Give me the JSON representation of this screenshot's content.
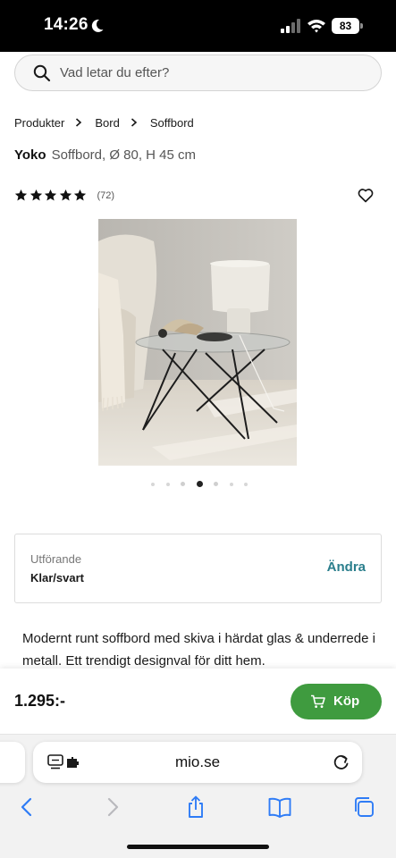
{
  "status_bar": {
    "time": "14:26",
    "battery": "83"
  },
  "search": {
    "placeholder": "Vad letar du efter?"
  },
  "breadcrumb": [
    "Produkter",
    "Bord",
    "Soffbord"
  ],
  "product": {
    "brand": "Yoko",
    "description_short": "Soffbord, Ø 80, H 45 cm",
    "rating_stars": 5,
    "rating_count": "(72)",
    "image_count": 7,
    "active_image_index": 3
  },
  "variant": {
    "label": "Utförande",
    "value": "Klar/svart",
    "change_label": "Ändra"
  },
  "description": "Modernt runt soffbord med skiva i härdat glas & underrede i metall. Ett trendigt designval för ditt hem.",
  "buy_bar": {
    "price": "1.295:-",
    "button_label": "Köp"
  },
  "browser": {
    "address": "mio.se"
  },
  "icons": {
    "search": "search-icon",
    "breadcrumb_separator": "chevron-right-icon",
    "rating": "star-icon",
    "favorite": "heart-icon",
    "cart": "cart-icon",
    "reader": "reader-mode-icon",
    "reload": "reload-icon",
    "toolbar": [
      "back-icon",
      "forward-icon",
      "share-icon",
      "bookmarks-icon",
      "tabs-icon"
    ]
  },
  "colors": {
    "buy_button": "#3f9b3f",
    "change_link": "#2a7e8c",
    "safari_blue": "#2f7cf6"
  }
}
